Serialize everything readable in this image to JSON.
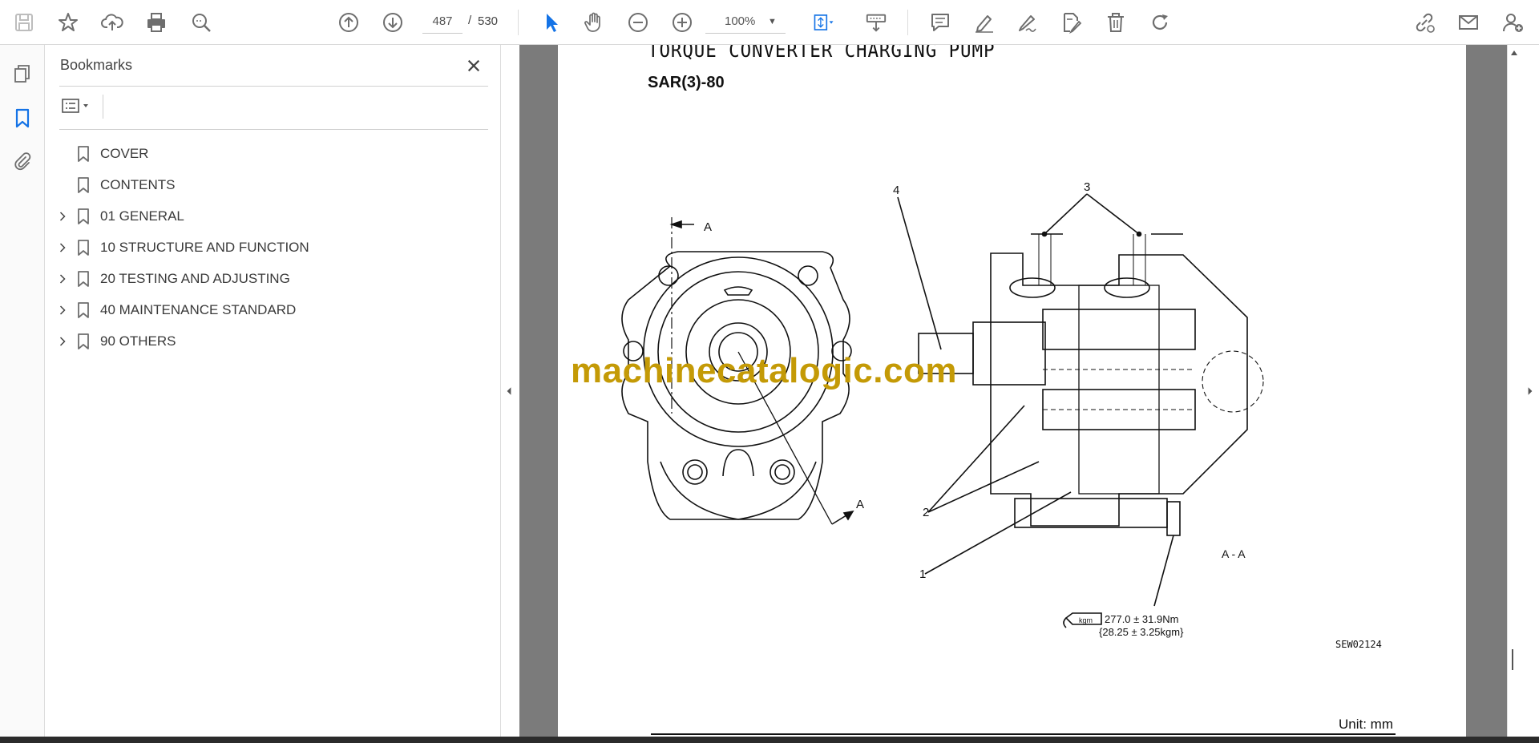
{
  "toolbar": {
    "current_page": "487",
    "page_separator": "/",
    "total_pages": "530",
    "zoom": "100%"
  },
  "bookmarks_panel": {
    "title": "Bookmarks",
    "items": [
      {
        "label": "COVER",
        "expandable": false
      },
      {
        "label": "CONTENTS",
        "expandable": false
      },
      {
        "label": "01 GENERAL",
        "expandable": true
      },
      {
        "label": "10 STRUCTURE AND FUNCTION",
        "expandable": true
      },
      {
        "label": "20 TESTING AND ADJUSTING",
        "expandable": true
      },
      {
        "label": "40 MAINTENANCE STANDARD",
        "expandable": true
      },
      {
        "label": "90 OTHERS",
        "expandable": true
      }
    ]
  },
  "document": {
    "title": "TORQUE CONVERTER CHARGING PUMP",
    "subtitle": "SAR(3)-80",
    "watermark": "machinecatalogic.com",
    "unit_label": "Unit: mm",
    "drawing": {
      "section_label_top": "A",
      "section_label_bottom": "A",
      "section_view_label": "A - A",
      "callout_1": "1",
      "callout_2": "2",
      "callout_3": "3",
      "callout_4": "4",
      "torque_value_nm": "277.0 ± 31.9Nm",
      "torque_value_kgm": "{28.25 ± 3.25kgm}",
      "torque_badge": "kgm",
      "figure_code": "SEW02124"
    }
  },
  "colors": {
    "accent_blue": "#1473e6",
    "watermark": "#c49a06",
    "icon_gray": "#6e6e6e",
    "page_gutter": "#7b7b7b"
  }
}
